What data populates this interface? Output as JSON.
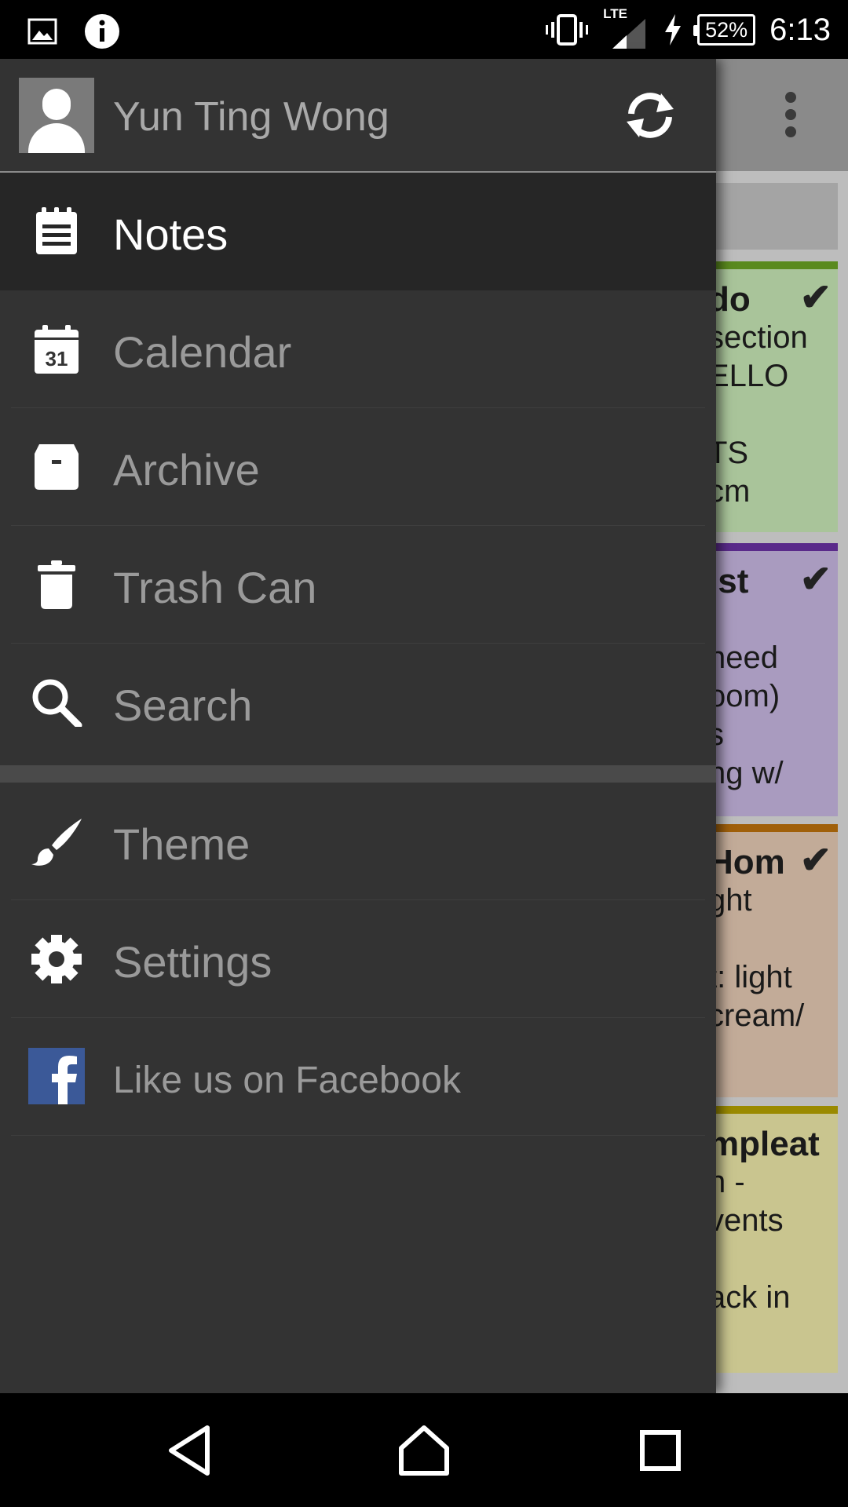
{
  "status_bar": {
    "time": "6:13",
    "battery_percent": "52%",
    "network_type": "LTE",
    "left_icons": [
      "image-icon",
      "info-icon"
    ],
    "right_icons": [
      "vibrate-icon",
      "signal-icon",
      "charging-icon",
      "battery-icon"
    ]
  },
  "drawer": {
    "user_name": "Yun Ting Wong",
    "items": [
      {
        "label": "Notes",
        "icon": "notepad-icon",
        "active": true
      },
      {
        "label": "Calendar",
        "icon": "calendar-icon",
        "active": false,
        "icon_text": "31"
      },
      {
        "label": "Archive",
        "icon": "archive-icon",
        "active": false
      },
      {
        "label": "Trash Can",
        "icon": "trash-icon",
        "active": false
      },
      {
        "label": "Search",
        "icon": "search-icon",
        "active": false
      },
      {
        "label": "Theme",
        "icon": "brush-icon",
        "active": false
      },
      {
        "label": "Settings",
        "icon": "gear-icon",
        "active": false
      },
      {
        "label": "Like us on Facebook",
        "icon": "facebook-icon",
        "active": false
      }
    ]
  },
  "background_notes": [
    {
      "title": "do",
      "lines": [
        "section",
        "ELLO",
        "",
        "TS",
        "cm"
      ],
      "color": "#a9c49a",
      "bar_color": "#5a8a1e",
      "checked": true
    },
    {
      "title": "ist",
      "lines": [
        ":",
        "need",
        "oom)",
        "s",
        "ng w/"
      ],
      "color": "#a99bbf",
      "bar_color": "#5a2a8a",
      "checked": true
    },
    {
      "title": "Hom",
      "lines": [
        "ght",
        "",
        "t: light",
        "cream/",
        ""
      ],
      "color": "#c2ab98",
      "bar_color": "#a0600a",
      "checked": true
    },
    {
      "title": "mpleat",
      "lines": [
        "n -",
        "vents",
        "",
        "ack in"
      ],
      "color": "#c9c58f",
      "bar_color": "#9a8a00",
      "checked": false
    }
  ],
  "nav_bar": [
    "back-icon",
    "home-icon",
    "recents-icon"
  ]
}
